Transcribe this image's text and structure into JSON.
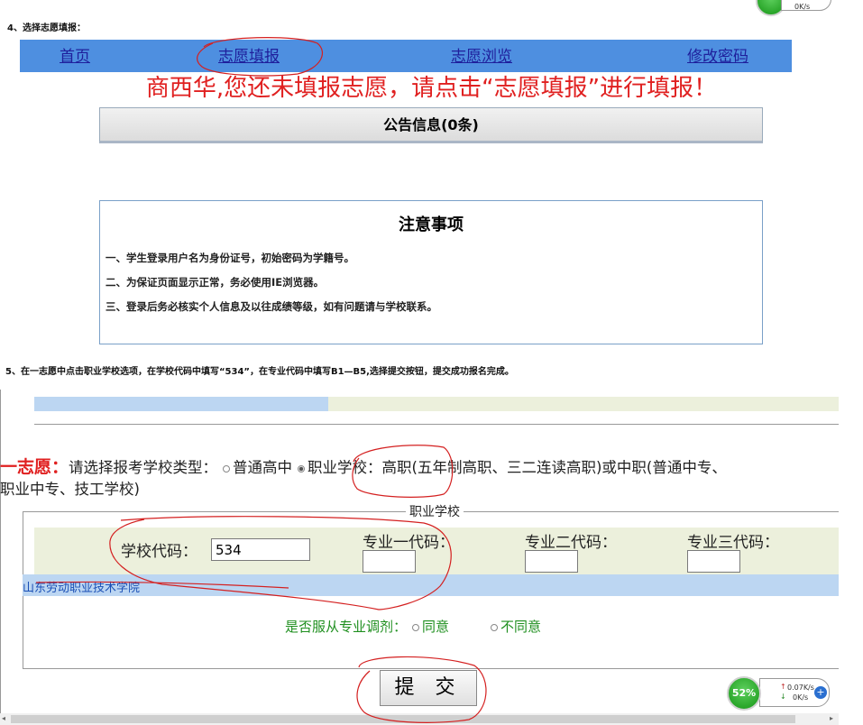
{
  "step4": {
    "text": "4、选择志愿填报："
  },
  "nav": {
    "home": "首页",
    "fill": "志愿填报",
    "browse": "志愿浏览",
    "password": "修改密码"
  },
  "warning": "商西华,您还未填报志愿，请点击“志愿填报”进行填报！",
  "notice": {
    "title": "公告信息(0条)"
  },
  "caution": {
    "title": "注意事项",
    "lines": [
      "一、学生登录用户名为身份证号，初始密码为学籍号。",
      "二、为保证页面显示正常，务必使用IE浏览器。",
      "三、登录后务必核实个人信息及以往成绩等级，如有问题请与学校联系。"
    ]
  },
  "step5": {
    "text": "5、在一志愿中点击职业学校选项，在学校代码中填写“534”，在专业代码中填写B1—B5,选择提交按钮，提交成功报名完成。"
  },
  "form": {
    "first_choice_label": "一志愿：",
    "prompt": "请选择报考学校类型：",
    "option_general": "普通高中",
    "option_vocational": "职业学校：",
    "vocational_desc": "高职(五年制高职、三二连读高职)或中职(普通中专、",
    "vocational_desc2": "职业中专、技工学校)",
    "legend": "职业学校",
    "school_code_label": "学校代码：",
    "school_code_value": "534",
    "major1_label": "专业一代码：",
    "major2_label": "专业二代码：",
    "major3_label": "专业三代码：",
    "school_name": "山东劳动职业技术学院",
    "adjust_label": "是否服从专业调剂：",
    "agree": "同意",
    "disagree": "不同意",
    "submit": "提 交"
  },
  "speed_widget": {
    "percent": "52%",
    "up": "0.07K/s",
    "down": "0K/s",
    "top_down": "0K/s"
  },
  "colors": {
    "nav_bg": "#4e8fe0",
    "warning": "#e02020",
    "annotation": "#d42020",
    "adjust_green": "#1f8f1f"
  }
}
